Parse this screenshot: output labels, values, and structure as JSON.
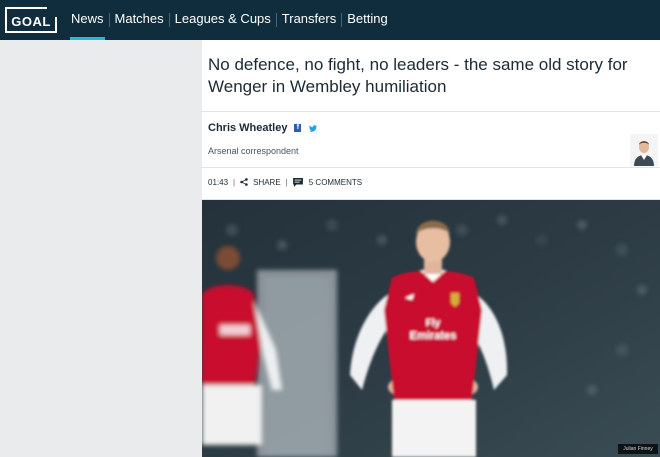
{
  "brand": {
    "logo_text": "GOAL"
  },
  "nav": {
    "items": [
      {
        "label": "News",
        "active": true
      },
      {
        "label": "Matches"
      },
      {
        "label": "Leagues & Cups"
      },
      {
        "label": "Transfers"
      },
      {
        "label": "Betting"
      }
    ]
  },
  "article": {
    "headline": "No defence, no fight, no leaders - the same old story for Wenger in Wembley humiliation",
    "author": {
      "name": "Chris Wheatley",
      "role": "Arsenal correspondent"
    },
    "meta": {
      "time": "01:43",
      "share_label": "SHARE",
      "comments_label": "5 COMMENTS"
    },
    "photo_credit": "Julian Finney"
  },
  "colors": {
    "nav_bg": "#0f2d3c",
    "accent": "#29b6d8",
    "facebook": "#2b5fa8",
    "twitter": "#1da1f2",
    "kit_red": "#c8102e"
  },
  "icons": [
    "facebook-icon",
    "twitter-icon",
    "share-icon",
    "comment-icon"
  ]
}
